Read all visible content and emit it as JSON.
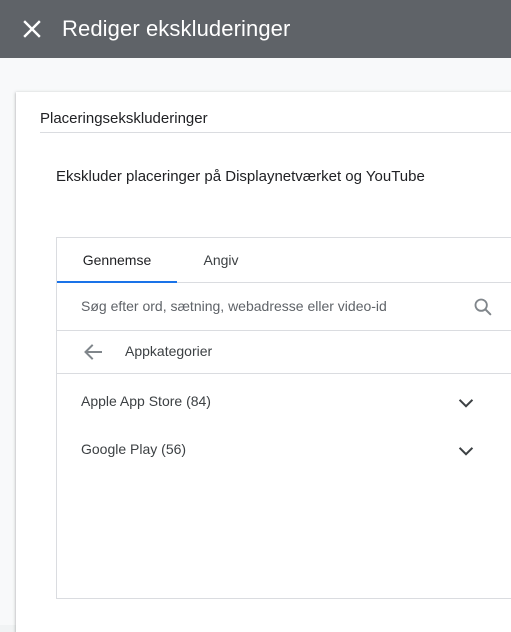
{
  "header": {
    "title": "Rediger ekskluderinger",
    "close_icon": "close-icon"
  },
  "card": {
    "section_title": "Placeringsekskluderinger",
    "subtitle": "Ekskluder placeringer på Displaynetværket og YouTube"
  },
  "tabs": [
    {
      "label": "Gennemse",
      "active": true
    },
    {
      "label": "Angiv",
      "active": false
    }
  ],
  "search": {
    "value": "",
    "placeholder": "Søg efter ord, sætning, webadresse eller video-id",
    "icon": "search-icon"
  },
  "breadcrumb": {
    "back_icon": "arrow-back-icon",
    "label": "Appkategorier"
  },
  "categories": [
    {
      "label": "Apple App Store (84)",
      "icon": "chevron-down-icon"
    },
    {
      "label": "Google Play (56)",
      "icon": "chevron-down-icon"
    }
  ],
  "colors": {
    "header_bg": "#5f6368",
    "accent": "#1a73e8",
    "divider": "#dadce0"
  }
}
